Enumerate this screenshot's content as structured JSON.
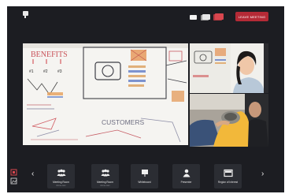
{
  "header": {
    "leave_button": "LEAVE MEETING"
  },
  "toolbar": {
    "prev_arrow": "‹",
    "next_arrow": "›",
    "buttons": [
      {
        "icon": "people-group-icon",
        "label": "Meeting Room",
        "sub": "drone-cam"
      },
      {
        "icon": "people-group-icon",
        "label": "Meeting Room",
        "sub": "drone-cam"
      },
      {
        "icon": "whiteboard-icon",
        "label": "Whiteboard",
        "sub": ""
      },
      {
        "icon": "presenter-icon",
        "label": "Presenter",
        "sub": ""
      },
      {
        "icon": "region-of-interest-icon",
        "label": "Region of Interest",
        "sub": ""
      }
    ]
  },
  "whiteboard": {
    "heading": "BENEFITS",
    "items": [
      "#1",
      "#2",
      "#3"
    ],
    "footer": "CUSTOMERS"
  },
  "colors": {
    "background": "#1c1d22",
    "leave_button": "#b52a36",
    "accent_red": "#d8464e"
  }
}
